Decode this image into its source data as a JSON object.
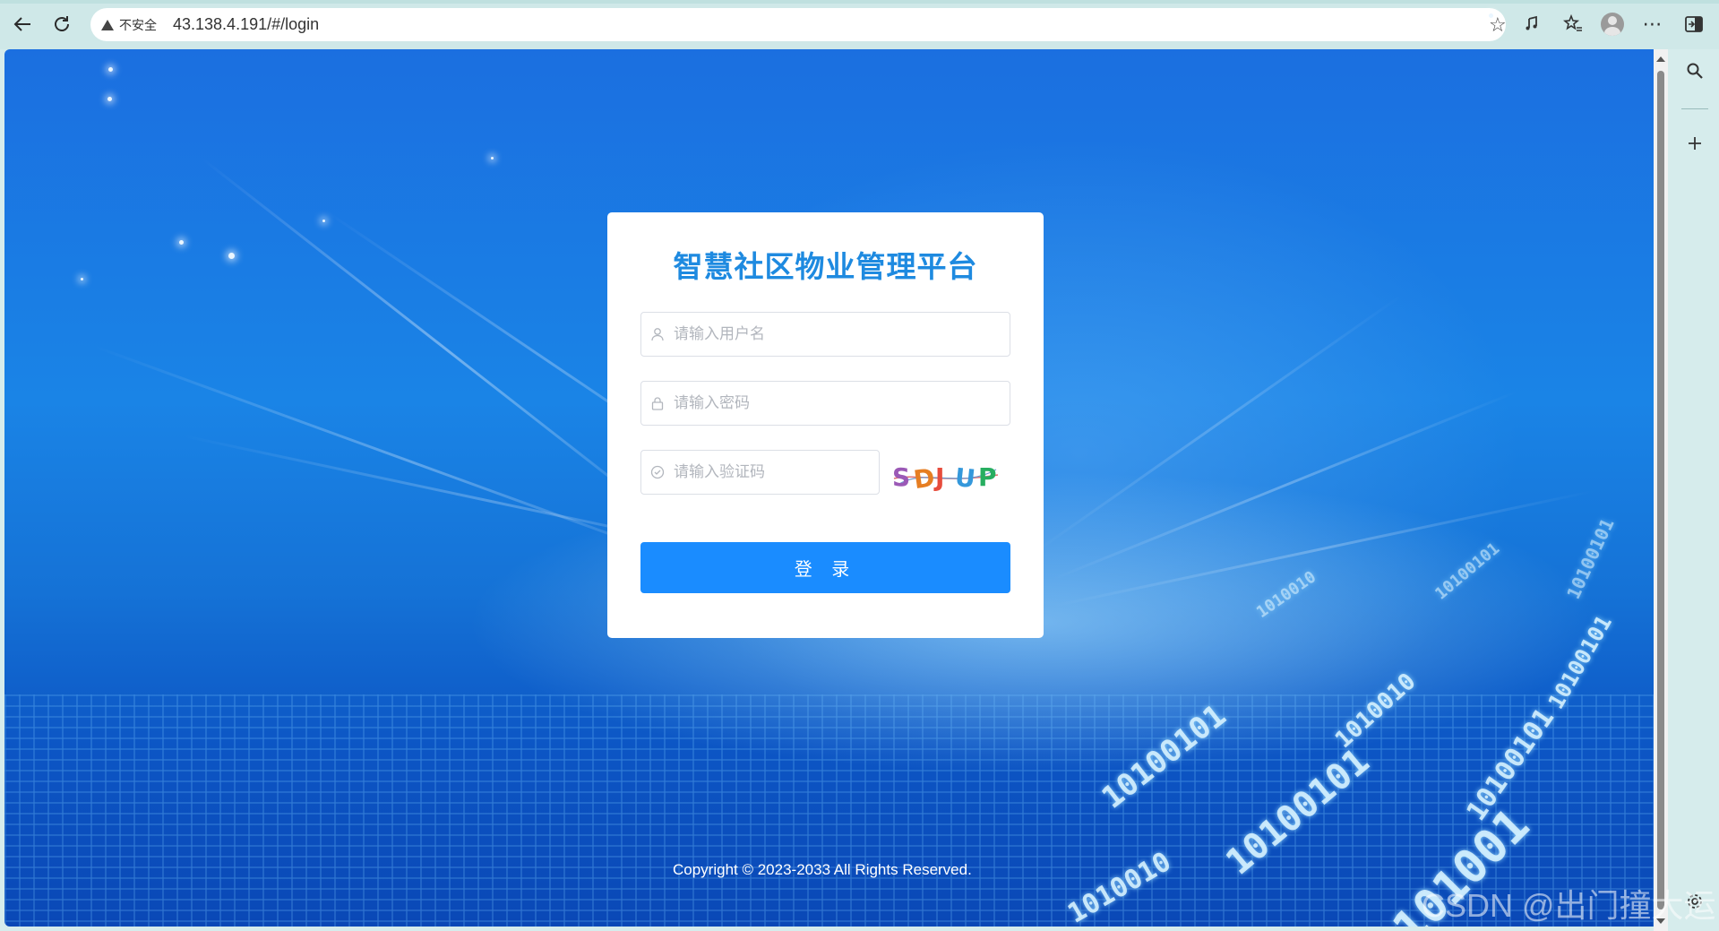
{
  "browser": {
    "security_label": "不安全",
    "url": "43.138.4.191/#/login"
  },
  "login": {
    "title": "智慧社区物业管理平台",
    "username_placeholder": "请输入用户名",
    "password_placeholder": "请输入密码",
    "captcha_placeholder": "请输入验证码",
    "captcha_text": "SDJUP",
    "login_button": "登 录"
  },
  "footer": {
    "copyright": "Copyright © 2023-2033 All Rights Reserved."
  },
  "watermark": "CSDN @出门撞大运",
  "colors": {
    "title": "#1e8ae0",
    "button": "#1a8cff",
    "background_top": "#1b6fe0",
    "background_bottom": "#0a48b6"
  },
  "binary_text": [
    "10100101",
    "10100101",
    "101001",
    "1010010",
    "10100101",
    "10100101",
    "1010010",
    "10100101",
    "1010010",
    "10100101"
  ]
}
